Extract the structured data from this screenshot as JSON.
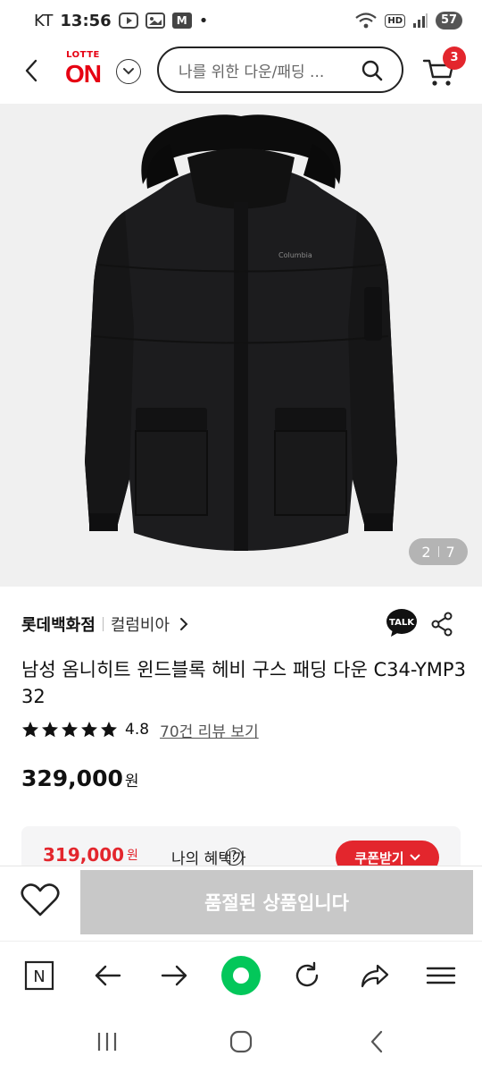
{
  "status_bar": {
    "carrier": "KT",
    "time": "13:56",
    "notification_m": "M",
    "dot": "•",
    "hd": "HD",
    "battery": "57"
  },
  "header": {
    "logo_top": "LOTTE",
    "logo_bottom": "ON",
    "search_placeholder": "나를 위한 다운/패딩 ...",
    "cart_count": "3",
    "accent_color": "#e60012"
  },
  "gallery": {
    "current": "2",
    "total": "7",
    "image_label": "Columbia"
  },
  "product": {
    "store": "롯데백화점",
    "brand": "컬럼비아",
    "talk": "TALK",
    "title": "남성 옴니히트 윈드블록 헤비 구스 패딩 다운 C34-YMP332",
    "rating": "4.8",
    "review_link": "70건 리뷰 보기",
    "star_count": 5,
    "price": "329,000",
    "currency": "원"
  },
  "benefit": {
    "sale_price": "319,000",
    "currency": "원",
    "label": "나의 혜택가",
    "help": "?",
    "coupon_button": "쿠폰받기"
  },
  "purchase_bar": {
    "soldout_label": "품절된 상품입니다"
  },
  "browser_bar": {
    "home_letter": "N"
  }
}
